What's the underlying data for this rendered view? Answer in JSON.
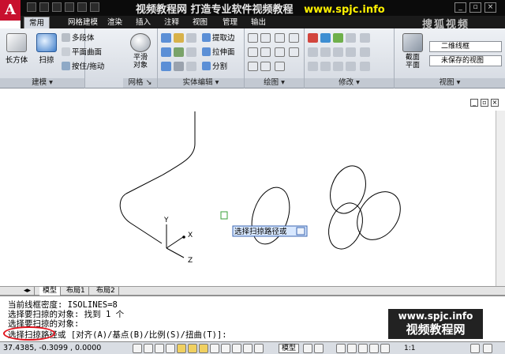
{
  "watermark": {
    "title": "视频教程网 打造专业软件视频教程",
    "url": "www.spjc.info",
    "souhu": "搜狐视频",
    "bottom_url": "www.spjc.info",
    "bottom_text": "视频教程网"
  },
  "app": {
    "logo": "A"
  },
  "tabs": [
    "常用",
    "网格建模",
    "渲染",
    "插入",
    "注释",
    "视图",
    "管理",
    "输出"
  ],
  "ribbon": {
    "modeling": {
      "label": "建模",
      "box": "长方体",
      "sweep": "扫掠",
      "polysolid": "多段体",
      "planar": "平面曲面",
      "presspull": "按住/拖动"
    },
    "mesh": {
      "label": "网格",
      "smooth_line1": "平滑",
      "smooth_line2": "对象"
    },
    "solid_edit": {
      "label": "实体编辑",
      "extract": "提取边",
      "extrude_face": "拉伸面",
      "separate": "分割"
    },
    "draw": {
      "label": "绘图"
    },
    "modify": {
      "label": "修改"
    },
    "section": {
      "btn_line1": "截面",
      "btn_line2": "平面"
    },
    "view": {
      "label": "视图",
      "visual_style": "二维线框",
      "saved_view": "未保存的视图"
    }
  },
  "tooltip": {
    "text": "选择扫掠路径或"
  },
  "ucs": {
    "x": "X",
    "y": "Y",
    "z": "Z"
  },
  "sheet_tabs": [
    "模型",
    "布局1",
    "布局2"
  ],
  "command": {
    "lines": [
      "当前线框密度:  ISOLINES=8",
      "选择要扫掠的对象: 找到 1 个",
      "选择要扫掠的对象:",
      "选择扫掠路径或 [对齐(A)/基点(B)/比例(S)/扭曲(T)]:"
    ]
  },
  "status": {
    "coords": "37.4385, -0.3099 , 0.0000",
    "model": "模型",
    "scale": "1:1"
  }
}
